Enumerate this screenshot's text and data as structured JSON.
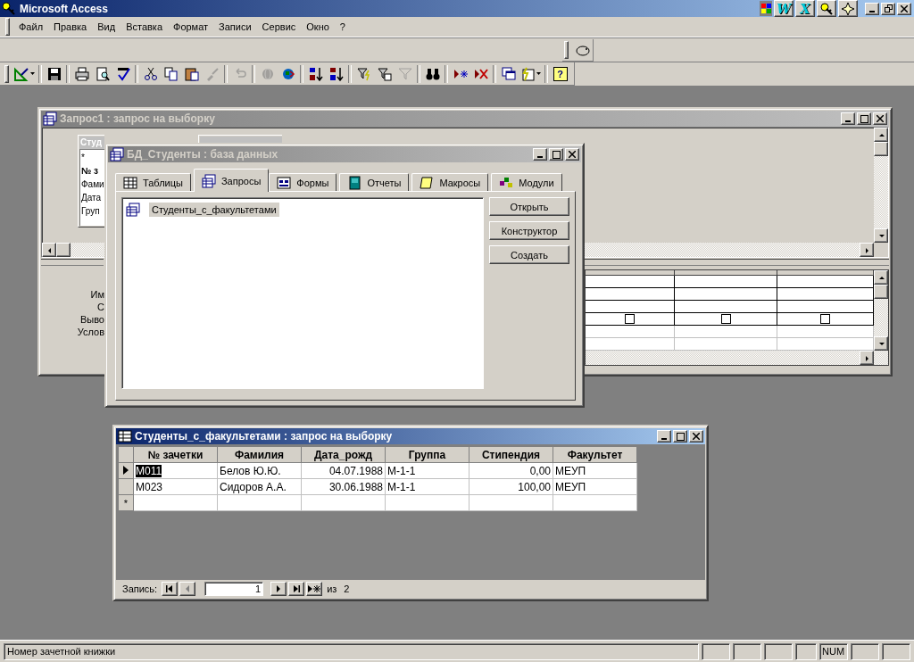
{
  "app_title": "Microsoft Access",
  "office_bar": [
    {
      "kind": "flag"
    },
    {
      "kind": "letter",
      "glyph": "W"
    },
    {
      "kind": "letter",
      "glyph": "X"
    },
    {
      "kind": "key"
    },
    {
      "kind": "star"
    }
  ],
  "menu": [
    "Файл",
    "Правка",
    "Вид",
    "Вставка",
    "Формат",
    "Записи",
    "Сервис",
    "Окно",
    "?"
  ],
  "toolbar": [
    {
      "kind": "view",
      "dropdown": true,
      "disabled": false
    },
    {
      "kind": "sep"
    },
    {
      "kind": "save",
      "disabled": false
    },
    {
      "kind": "sep"
    },
    {
      "kind": "print",
      "disabled": false
    },
    {
      "kind": "preview",
      "disabled": false
    },
    {
      "kind": "spell",
      "disabled": false
    },
    {
      "kind": "sep"
    },
    {
      "kind": "cut",
      "disabled": false
    },
    {
      "kind": "copy",
      "disabled": false
    },
    {
      "kind": "paste",
      "disabled": false
    },
    {
      "kind": "brush",
      "disabled": true
    },
    {
      "kind": "sep"
    },
    {
      "kind": "undo",
      "disabled": true
    },
    {
      "kind": "sep"
    },
    {
      "kind": "globe",
      "disabled": true
    },
    {
      "kind": "web",
      "disabled": false
    },
    {
      "kind": "sep"
    },
    {
      "kind": "sortasc",
      "disabled": false
    },
    {
      "kind": "sortdesc",
      "disabled": false
    },
    {
      "kind": "sep"
    },
    {
      "kind": "filtersel",
      "disabled": false
    },
    {
      "kind": "filterform",
      "disabled": false
    },
    {
      "kind": "filter",
      "disabled": true
    },
    {
      "kind": "sep"
    },
    {
      "kind": "find",
      "disabled": false
    },
    {
      "kind": "sep"
    },
    {
      "kind": "newrec",
      "disabled": false
    },
    {
      "kind": "delrec",
      "disabled": false
    },
    {
      "kind": "sep"
    },
    {
      "kind": "dbwin",
      "disabled": false
    },
    {
      "kind": "newobj",
      "dropdown": true,
      "disabled": false
    },
    {
      "kind": "sep"
    },
    {
      "kind": "help",
      "glyph": "?",
      "disabled": false
    }
  ],
  "query_window": {
    "title": "Запрос1 : запрос на выборку",
    "active": false,
    "table_box": {
      "title": "Студ",
      "fields": [
        {
          "text": "*",
          "bold": false
        },
        {
          "text": "№ з",
          "bold": true
        },
        {
          "text": "Фами",
          "bold": false
        },
        {
          "text": "Дата",
          "bold": false
        },
        {
          "text": "Груп",
          "bold": false
        }
      ]
    },
    "grid_labels": [
      "Им",
      "С",
      "Выво",
      "Услов"
    ],
    "grid_columns": [
      {
        "show": false
      },
      {
        "show": false
      },
      {
        "show": false
      }
    ]
  },
  "db_window": {
    "title": "БД_Студенты : база данных",
    "active": false,
    "tabs": [
      {
        "label": "Таблицы",
        "kind": "table",
        "selected": false
      },
      {
        "label": "Запросы",
        "kind": "query",
        "selected": true
      },
      {
        "label": "Формы",
        "kind": "form",
        "selected": false
      },
      {
        "label": "Отчеты",
        "kind": "report",
        "selected": false
      },
      {
        "label": "Макросы",
        "kind": "macro",
        "selected": false
      },
      {
        "label": "Модули",
        "kind": "module",
        "selected": false
      }
    ],
    "items": [
      {
        "label": "Студенты_с_факультетами",
        "selected": true
      }
    ],
    "buttons": [
      "Открыть",
      "Конструктор",
      "Создать"
    ]
  },
  "datasheet": {
    "title": "Студенты_с_факультетами : запрос на выборку",
    "active": true,
    "columns": [
      {
        "label": "№ зачетки",
        "kind": "text"
      },
      {
        "label": "Фамилия",
        "kind": "text"
      },
      {
        "label": "Дата_рожд",
        "kind": "number"
      },
      {
        "label": "Группа",
        "kind": "text"
      },
      {
        "label": "Стипендия",
        "kind": "number"
      },
      {
        "label": "Факультет",
        "kind": "text"
      }
    ],
    "rows": [
      {
        "current": true,
        "cells": [
          {
            "text": "M011",
            "selected": true
          },
          {
            "text": "Белов Ю.Ю.",
            "selected": false
          },
          {
            "text": "04.07.1988",
            "selected": false
          },
          {
            "text": "М-1-1",
            "selected": false
          },
          {
            "text": "0,00",
            "selected": false
          },
          {
            "text": "МЕУП",
            "selected": false
          }
        ]
      },
      {
        "current": false,
        "cells": [
          {
            "text": "M023",
            "selected": false
          },
          {
            "text": "Сидоров А.А.",
            "selected": false
          },
          {
            "text": "30.06.1988",
            "selected": false
          },
          {
            "text": "М-1-1",
            "selected": false
          },
          {
            "text": "100,00",
            "selected": false
          },
          {
            "text": "МЕУП",
            "selected": false
          }
        ]
      }
    ],
    "new_row_mark": "*",
    "nav": {
      "label": "Запись:",
      "value": "1",
      "of": "из",
      "total": "2"
    }
  },
  "status_bar": {
    "text": "Номер зачетной книжки",
    "indicator": "NUM"
  }
}
